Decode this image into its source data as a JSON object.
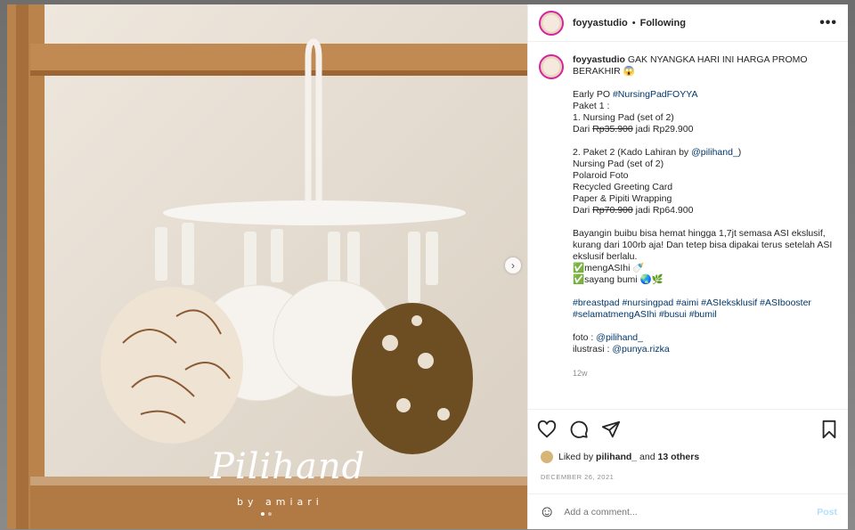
{
  "post": {
    "username": "foyyastudio",
    "separator": "•",
    "following_label": "Following",
    "more_label": "•••",
    "watermark_title": "Pilihand",
    "watermark_sub": "by amiari",
    "caption_head": "GAK NYANGKA HARI INI HARGA PROMO BERAKHIR",
    "caption_emoji": "😱",
    "caption_lines": {
      "l1": "Early PO",
      "l1_tag": "#NursingPadFOYYA",
      "l2": "Paket 1 :",
      "l3": "1. Nursing Pad (set of 2)",
      "l4_pre": "Dari",
      "l4_old": "Rp35.900",
      "l4_post": "jadi Rp29.900",
      "l5_pre": "2. Paket 2 (Kado Lahiran by",
      "l5_tag": "@pilihand_",
      "l5_post": ")",
      "l6": "Nursing Pad (set of 2)",
      "l7": "Polaroid Foto",
      "l8": "Recycled Greeting Card",
      "l9": "Paper & Pipiti Wrapping",
      "l10_pre": "Dari",
      "l10_old": "Rp70.900",
      "l10_post": "jadi Rp64.900",
      "l11": "Bayangin buibu bisa hemat hingga 1,7jt semasa ASI ekslusif, kurang dari 100rb aja! Dan tetep bisa dipakai terus setelah ASI ekslusif berlalu.",
      "l12": "✅mengASIhi 🍼",
      "l13": "✅sayang bumi 🌏🌿",
      "l14": "#breastpad #nursingpad #aimi #ASIeksklusif #ASIbooster #selamatmengASIhi #busui #bumil",
      "l15_pre": "foto :",
      "l15_tag": "@pilihand_",
      "l16_pre": "ilustrasi :",
      "l16_tag": "@punya.rizka"
    },
    "time_ago": "12w",
    "liked_by_prefix": "Liked by",
    "liked_by_user": "pilihand_",
    "liked_by_and": "and",
    "liked_by_others": "13 others",
    "date": "DECEMBER 26, 2021",
    "comment_placeholder": "Add a comment...",
    "post_label": "Post"
  },
  "icons": {
    "next": "chevron-right-icon",
    "heart": "heart-icon",
    "comment": "comment-icon",
    "share": "share-icon",
    "bookmark": "bookmark-icon",
    "emoji": "emoji-icon"
  },
  "colors": {
    "link": "#00376b",
    "story_ring": "#d6249f",
    "post_button": "#b2dffc"
  }
}
